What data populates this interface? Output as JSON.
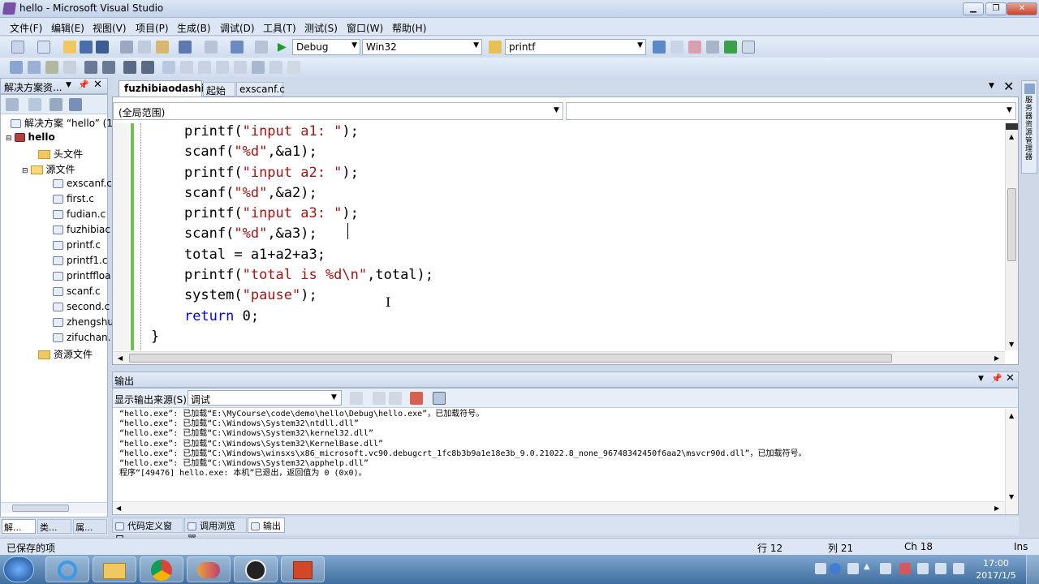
{
  "window": {
    "title": "hello - Microsoft Visual Studio"
  },
  "menu": [
    "文件(F)",
    "编辑(E)",
    "视图(V)",
    "项目(P)",
    "生成(B)",
    "调试(D)",
    "工具(T)",
    "测试(S)",
    "窗口(W)",
    "帮助(H)"
  ],
  "toolbar": {
    "config": "Debug",
    "platform": "Win32",
    "find": "printf"
  },
  "solution_panel": {
    "title": "解决方案资...",
    "solution": "解决方案 “hello” (1",
    "project": "hello",
    "items": [
      {
        "label": "头文件",
        "kind": "folder"
      },
      {
        "label": "源文件",
        "kind": "folder"
      },
      {
        "label": "exscanf.c",
        "kind": "file"
      },
      {
        "label": "first.c",
        "kind": "file"
      },
      {
        "label": "fudian.c",
        "kind": "file"
      },
      {
        "label": "fuzhibiac",
        "kind": "file"
      },
      {
        "label": "printf.c",
        "kind": "file"
      },
      {
        "label": "printf1.c",
        "kind": "file"
      },
      {
        "label": "printffloa",
        "kind": "file"
      },
      {
        "label": "scanf.c",
        "kind": "file"
      },
      {
        "label": "second.c",
        "kind": "file"
      },
      {
        "label": "zhengshu",
        "kind": "file"
      },
      {
        "label": "zifuchan.",
        "kind": "file"
      },
      {
        "label": "资源文件",
        "kind": "folder"
      }
    ],
    "bottom_tabs": [
      "解...",
      "类...",
      "属..."
    ]
  },
  "editor": {
    "tabs": [
      "fuzhibiaodashi.c",
      "起始页",
      "exscanf.c"
    ],
    "scope": "(全局范围)",
    "lines": [
      [
        {
          "t": "    printf(",
          "c": "p"
        },
        {
          "t": "\"input a1: \"",
          "c": "s"
        },
        {
          "t": ");",
          "c": "p"
        }
      ],
      [
        {
          "t": "    scanf(",
          "c": "p"
        },
        {
          "t": "\"%d\"",
          "c": "s"
        },
        {
          "t": ",&a1);",
          "c": "p"
        }
      ],
      [
        {
          "t": "    printf(",
          "c": "p"
        },
        {
          "t": "\"input a2: \"",
          "c": "s"
        },
        {
          "t": ");",
          "c": "p"
        }
      ],
      [
        {
          "t": "    scanf(",
          "c": "p"
        },
        {
          "t": "\"%d\"",
          "c": "s"
        },
        {
          "t": ",&a2);",
          "c": "p"
        }
      ],
      [
        {
          "t": "    printf(",
          "c": "p"
        },
        {
          "t": "\"input a3: \"",
          "c": "s"
        },
        {
          "t": ");",
          "c": "p"
        }
      ],
      [
        {
          "t": "    scanf(",
          "c": "p"
        },
        {
          "t": "\"%d\"",
          "c": "s"
        },
        {
          "t": ",&a3);",
          "c": "p"
        }
      ],
      [
        {
          "t": "    total = a1+a2+a3;",
          "c": "p"
        }
      ],
      [
        {
          "t": "    printf(",
          "c": "p"
        },
        {
          "t": "\"total is %d\\n\"",
          "c": "s"
        },
        {
          "t": ",total);",
          "c": "p"
        }
      ],
      [
        {
          "t": "    system(",
          "c": "p"
        },
        {
          "t": "\"pause\"",
          "c": "s"
        },
        {
          "t": ");",
          "c": "p"
        }
      ],
      [
        {
          "t": "    ",
          "c": "p"
        },
        {
          "t": "return",
          "c": "k"
        },
        {
          "t": " 0;",
          "c": "p"
        }
      ],
      [
        {
          "t": "}",
          "c": "p"
        }
      ]
    ]
  },
  "output": {
    "title": "输出",
    "source_label": "显示输出来源(S):",
    "source_value": "调试",
    "lines": [
      "“hello.exe”: 已加载“E:\\MyCourse\\code\\demo\\hello\\Debug\\hello.exe”，已加载符号。",
      "“hello.exe”: 已加载“C:\\Windows\\System32\\ntdll.dll”",
      "“hello.exe”: 已加载“C:\\Windows\\System32\\kernel32.dll”",
      "“hello.exe”: 已加载“C:\\Windows\\System32\\KernelBase.dll”",
      "“hello.exe”: 已加载“C:\\Windows\\winsxs\\x86_microsoft.vc90.debugcrt_1fc8b3b9a1e18e3b_9.0.21022.8_none_96748342450f6aa2\\msvcr90d.dll”，已加载符号。",
      "“hello.exe”: 已加载“C:\\Windows\\System32\\apphelp.dll”",
      "程序“[49476] hello.exe: 本机”已退出，返回值为 0 (0x0)。"
    ],
    "bottom_tabs": [
      "代码定义窗口",
      "调用浏览器",
      "输出"
    ]
  },
  "status": {
    "left": "已保存的项",
    "line": "行 12",
    "col": "列 21",
    "ch": "Ch 18",
    "mode": "Ins"
  },
  "clock": {
    "time": "17:00",
    "date": "2017/1/5"
  },
  "right_strip": "服务器资源管理器",
  "colors": {
    "string": "#a31515",
    "keyword": "#0000ff",
    "plain": "#000000"
  }
}
